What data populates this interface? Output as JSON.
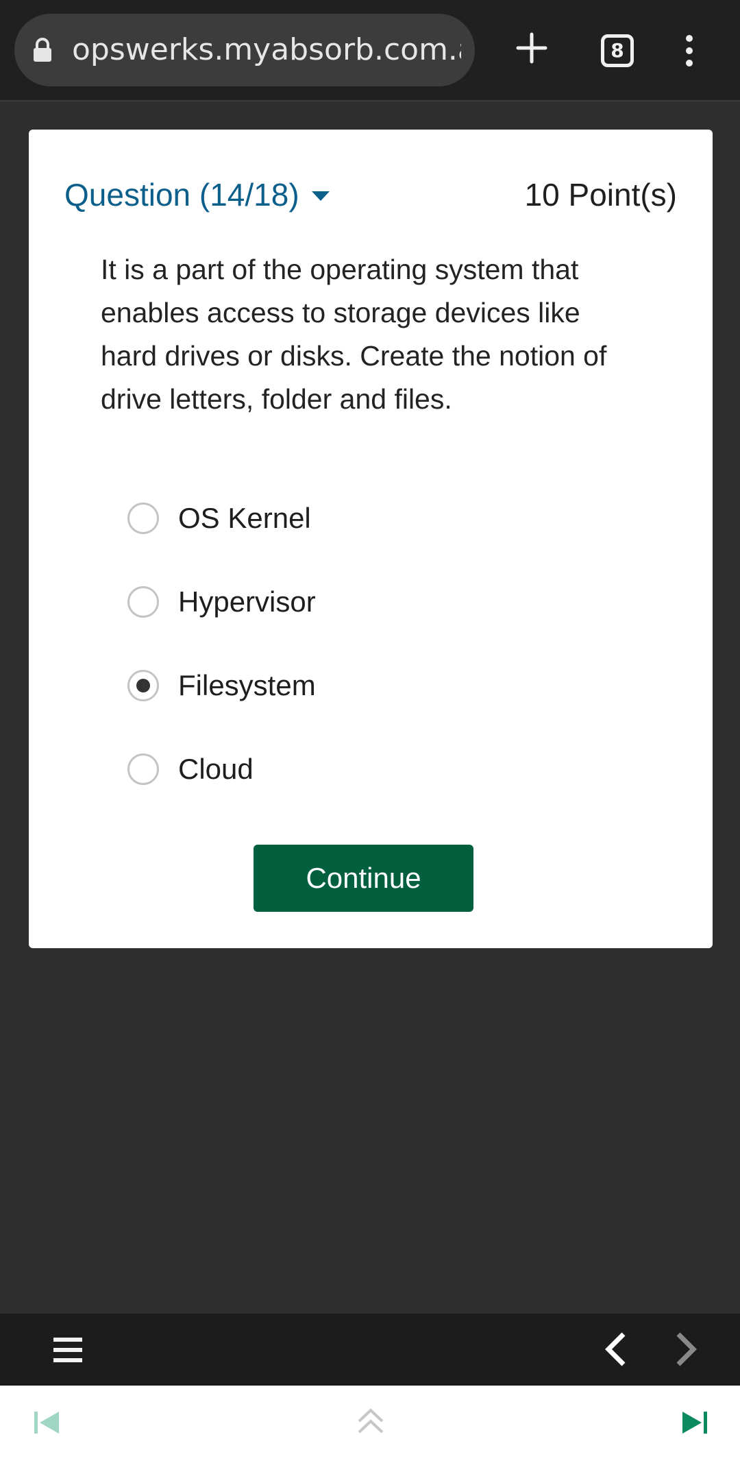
{
  "browser": {
    "url": "opswerks.myabsorb.com.au",
    "tab_count": "8"
  },
  "quiz": {
    "question_label": "Question (14/18)",
    "points": "10 Point(s)",
    "question_text": "It is a part of the operating system that enables access to storage devices like hard drives or disks. Create the notion of drive letters, folder and files.",
    "options": [
      {
        "label": "OS Kernel",
        "selected": false
      },
      {
        "label": "Hypervisor",
        "selected": false
      },
      {
        "label": "Filesystem",
        "selected": true
      },
      {
        "label": "Cloud",
        "selected": false
      }
    ],
    "continue_label": "Continue"
  },
  "colors": {
    "accent_blue": "#0d5f8b",
    "continue_green": "#03603f",
    "nav_teal": "#0a8a5e"
  },
  "icons": {
    "lock": "lock-icon",
    "new_tab": "plus-icon",
    "menu": "hamburger-icon",
    "back": "chevron-left-icon",
    "forward": "chevron-right-icon",
    "first": "skip-first-icon",
    "scroll_top": "double-chevron-up-icon",
    "last": "skip-last-icon"
  }
}
